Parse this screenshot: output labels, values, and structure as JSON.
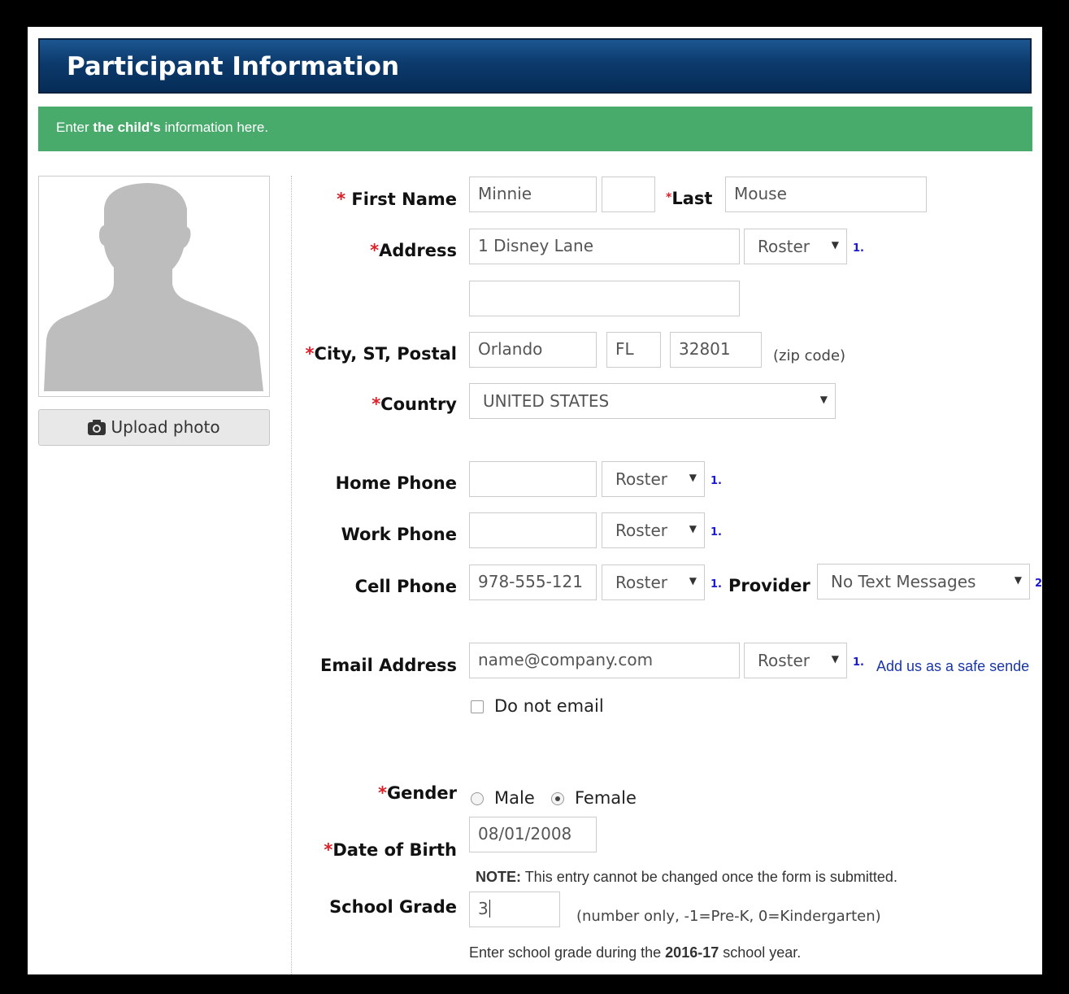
{
  "header": {
    "title": "Participant Information"
  },
  "info_bar": {
    "prefix": "Enter",
    "bold": "the child's",
    "suffix": "information here."
  },
  "photo": {
    "upload_label": "Upload photo",
    "icon": "camera-icon"
  },
  "labels": {
    "required_marker": "*",
    "first_name": "First Name",
    "last": "Last",
    "address": "Address",
    "city_st_postal": "City, ST, Postal",
    "country": "Country",
    "home_phone": "Home Phone",
    "work_phone": "Work Phone",
    "cell_phone": "Cell Phone",
    "provider": "Provider",
    "email_address": "Email Address",
    "gender": "Gender",
    "date_of_birth": "Date of Birth",
    "school_grade": "School Grade"
  },
  "fields": {
    "first_name": "Minnie",
    "middle": "",
    "last_name": "Mouse",
    "address1": "1 Disney Lane",
    "address2": "",
    "city": "Orlando",
    "state": "FL",
    "postal": "32801",
    "country": "UNITED STATES",
    "home_phone": "",
    "work_phone": "",
    "cell_phone": "978-555-121",
    "provider": "No Text Messages",
    "email_placeholder": "name@company.com",
    "dob": "08/01/2008",
    "school_grade": "3"
  },
  "roster_option": "Roster",
  "footnote_1": "1.",
  "footnote_2": "2",
  "hints": {
    "zip": "(zip code)",
    "grade": "(number only, -1=Pre-K, 0=Kindergarten)"
  },
  "safe_sender_link": "Add us as a safe sende",
  "do_not_email": "Do not email",
  "gender_options": {
    "male": "Male",
    "female": "Female",
    "selected": "Female"
  },
  "dob_note": {
    "bold": "NOTE:",
    "text": "This entry cannot be changed once the form is submitted."
  },
  "grade_note": {
    "prefix": "Enter school grade during the",
    "bold": "2016-17",
    "suffix": "school year."
  },
  "colors": {
    "title_bar": "#0c3a6c",
    "info_bar": "#48ab6b",
    "required": "#d9222a",
    "link": "#1a35a8"
  }
}
